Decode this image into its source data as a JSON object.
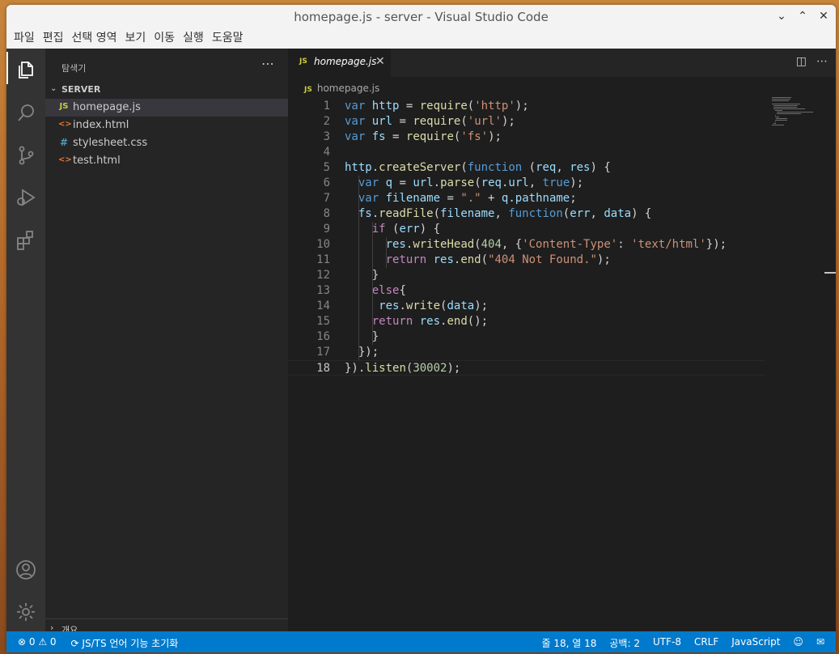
{
  "window": {
    "title": "homepage.js - server - Visual Studio Code"
  },
  "menu": [
    "파일",
    "편집",
    "선택 영역",
    "보기",
    "이동",
    "실행",
    "도움말"
  ],
  "activity_bar": {
    "items": [
      "files-icon",
      "search-icon",
      "source-control-icon",
      "run-debug-icon",
      "extensions-icon"
    ],
    "bottom": [
      "account-icon",
      "settings-gear-icon"
    ]
  },
  "sidebar": {
    "title": "탐색기",
    "folder": "SERVER",
    "files": [
      {
        "icon": "JS",
        "icon_color": "#cbcb41",
        "name": "homepage.js"
      },
      {
        "icon": "<>",
        "icon_color": "#e37933",
        "name": "index.html"
      },
      {
        "icon": "#",
        "icon_color": "#519aba",
        "name": "stylesheet.css"
      },
      {
        "icon": "<>",
        "icon_color": "#e37933",
        "name": "test.html"
      }
    ],
    "outline": "개요"
  },
  "editor": {
    "tab": {
      "icon": "JS",
      "label": "homepage.js"
    },
    "breadcrumb": {
      "icon": "JS",
      "label": "homepage.js"
    },
    "lines": [
      "var http = require('http');",
      "var url = require('url');",
      "var fs = require('fs');",
      "",
      "http.createServer(function (req, res) {",
      "  var q = url.parse(req.url, true);",
      "  var filename = \".\" + q.pathname;",
      "  fs.readFile(filename, function(err, data) {",
      "    if (err) {",
      "      res.writeHead(404, {'Content-Type': 'text/html'});",
      "      return res.end(\"404 Not Found.\");",
      "    }",
      "    else{",
      "     res.write(data);",
      "    return res.end();",
      "    }",
      "  });",
      "}).listen(30002);"
    ],
    "line_numbers": [
      "1",
      "2",
      "3",
      "4",
      "5",
      "6",
      "7",
      "8",
      "9",
      "10",
      "11",
      "12",
      "13",
      "14",
      "15",
      "16",
      "17",
      "18"
    ],
    "current_line": 18
  },
  "statusbar": {
    "errors": "0",
    "warnings": "0",
    "task": "JS/TS 언어 기능 초기화",
    "position": "줄 18, 열 18",
    "indent": "공백: 2",
    "encoding": "UTF-8",
    "eol": "CRLF",
    "language": "JavaScript"
  }
}
